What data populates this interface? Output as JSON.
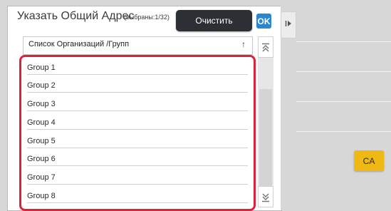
{
  "dialog": {
    "title": "Указать Общий Адрес",
    "selected_count": "(выбраны:1/32)",
    "clear_label": "Очистить",
    "ok_label": "OK"
  },
  "list": {
    "header_label": "Список Организаций /Групп",
    "sort_icon": "↑",
    "items": [
      {
        "label": "Group 1"
      },
      {
        "label": "Group 2"
      },
      {
        "label": "Group 3"
      },
      {
        "label": "Group 4"
      },
      {
        "label": "Group 5"
      },
      {
        "label": "Group 6"
      },
      {
        "label": "Group 7"
      },
      {
        "label": "Group 8"
      }
    ]
  },
  "scroll": {
    "top_icon": "scroll-to-top-icon",
    "bottom_icon": "scroll-to-bottom-icon"
  },
  "side_panel": {
    "collapse_icon": "expand-panel-icon",
    "ca_label": "CA"
  },
  "colors": {
    "highlight_border": "#d9243a",
    "ok_blue": "#2a86d0",
    "ca_yellow": "#f0b814",
    "dark_button": "#2c2f33"
  }
}
